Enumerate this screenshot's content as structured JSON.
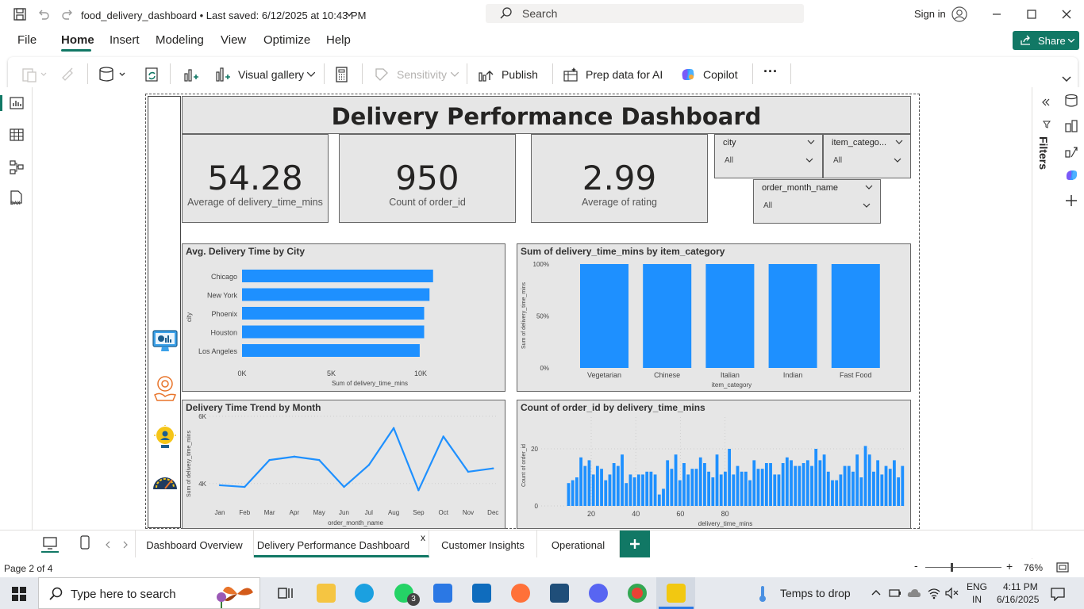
{
  "titlebar": {
    "filename": "food_delivery_dashboard • Last saved: 6/12/2025 at 10:43 PM",
    "search_placeholder": "Search",
    "signin": "Sign in"
  },
  "menu": [
    "File",
    "Home",
    "Insert",
    "Modeling",
    "View",
    "Optimize",
    "Help"
  ],
  "share_label": "Share",
  "ribbon": {
    "visual_gallery": "Visual gallery",
    "sensitivity": "Sensitivity",
    "publish": "Publish",
    "prep_data": "Prep data for AI",
    "copilot": "Copilot",
    "more": "···"
  },
  "right_pane": {
    "filters": "Filters"
  },
  "dashboard": {
    "title": "Delivery Performance Dashboard",
    "kpis": [
      {
        "value": "54.28",
        "label": "Average of delivery_time_mins"
      },
      {
        "value": "950",
        "label": "Count of order_id"
      },
      {
        "value": "2.99",
        "label": "Average of rating"
      }
    ],
    "slicers": [
      {
        "title": "city",
        "value": "All"
      },
      {
        "title": "item_catego...",
        "value": "All"
      },
      {
        "title": "order_month_name",
        "value": "All"
      }
    ]
  },
  "chart_data": [
    {
      "type": "bar",
      "orientation": "horizontal",
      "title": "Avg. Delivery Time by City",
      "ylabel": "city",
      "xlabel": "Sum of delivery_time_mins",
      "categories": [
        "Chicago",
        "New York",
        "Phoenix",
        "Houston",
        "Los Angeles"
      ],
      "values": [
        10700,
        10500,
        10200,
        10200,
        9950
      ],
      "xticks": [
        "0K",
        "5K",
        "10K"
      ],
      "xlim": [
        0,
        12000
      ],
      "color": "#1e90ff"
    },
    {
      "type": "bar",
      "title": "Sum of delivery_time_mins by item_category",
      "xlabel": "item_category",
      "ylabel": "Sum of delivery_time_mins",
      "categories": [
        "Vegetarian",
        "Chinese",
        "Italian",
        "Indian",
        "Fast Food"
      ],
      "values": [
        100,
        100,
        100,
        100,
        100
      ],
      "yticks": [
        "0%",
        "50%",
        "100%"
      ],
      "ylim": [
        0,
        100
      ],
      "color": "#1e90ff"
    },
    {
      "type": "line",
      "title": "Delivery Time Trend by Month",
      "xlabel": "order_month_name",
      "ylabel": "Sum of delivery_time_mins",
      "categories": [
        "Jan",
        "Feb",
        "Mar",
        "Apr",
        "May",
        "Jun",
        "Jul",
        "Aug",
        "Sep",
        "Oct",
        "Nov",
        "Dec"
      ],
      "values": [
        3950,
        3900,
        4700,
        4800,
        4700,
        3900,
        4550,
        5650,
        3800,
        5400,
        4350,
        4450
      ],
      "yticks": [
        "4K",
        "6K"
      ],
      "ylim": [
        3500,
        6000
      ],
      "color": "#1e90ff"
    },
    {
      "type": "bar",
      "title": "Count of order_id by delivery_time_mins",
      "xlabel": "delivery_time_mins",
      "ylabel": "Count of order_id",
      "x": [
        15,
        16,
        17,
        18,
        19,
        20,
        21,
        22,
        23,
        24,
        25,
        26,
        27,
        28,
        29,
        30,
        31,
        32,
        33,
        34,
        35,
        36,
        37,
        38,
        39,
        40,
        41,
        42,
        43,
        44,
        45,
        46,
        47,
        48,
        49,
        50,
        51,
        52,
        53,
        54,
        55,
        56,
        57,
        58,
        59,
        60,
        61,
        62,
        63,
        64,
        65,
        66,
        67,
        68,
        69,
        70,
        71,
        72,
        73,
        74,
        75,
        76,
        77,
        78,
        79,
        80,
        81,
        82,
        83,
        84,
        85,
        86,
        87,
        88,
        89,
        90
      ],
      "values": [
        8,
        9,
        10,
        17,
        14,
        16,
        11,
        14,
        13,
        9,
        11,
        15,
        14,
        18,
        8,
        11,
        10,
        11,
        11,
        12,
        12,
        11,
        4,
        6,
        16,
        13,
        18,
        9,
        15,
        11,
        13,
        13,
        17,
        15,
        12,
        10,
        18,
        11,
        12,
        20,
        11,
        14,
        12,
        12,
        9,
        16,
        13,
        13,
        15,
        15,
        11,
        11,
        15,
        17,
        16,
        14,
        14,
        15,
        16,
        14,
        20,
        16,
        18,
        12,
        9,
        9,
        11,
        14,
        14,
        12,
        18,
        10,
        21,
        18,
        12,
        16,
        11,
        14,
        13,
        16,
        10,
        14
      ],
      "xticks": [
        "20",
        "40",
        "60",
        "80"
      ],
      "yticks": [
        "0",
        "20"
      ],
      "ylim": [
        0,
        25
      ],
      "color": "#1e90ff"
    }
  ],
  "tabs": [
    "Dashboard Overview",
    "Delivery Performance Dashboard",
    "Customer Insights",
    "Operational"
  ],
  "tab_close": "x",
  "status": {
    "page": "Page 2 of 4",
    "zoom": "76%"
  },
  "taskbar": {
    "search_placeholder": "Type here to search",
    "weather": "Temps to drop",
    "lang1": "ENG",
    "lang2": "IN",
    "time": "4:11 PM",
    "date": "6/16/2025",
    "badge": "3"
  }
}
